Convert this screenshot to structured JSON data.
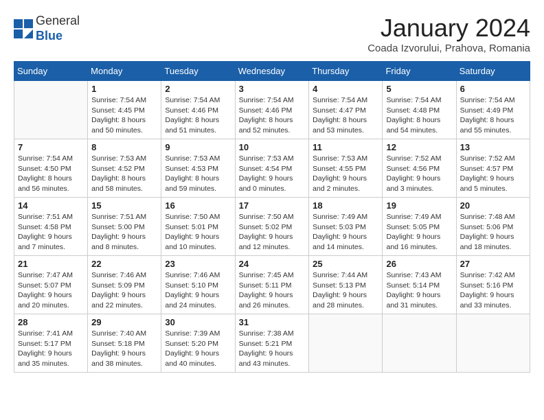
{
  "header": {
    "logo": {
      "line1": "General",
      "line2": "Blue"
    },
    "title": "January 2024",
    "location": "Coada Izvorului, Prahova, Romania"
  },
  "days_of_week": [
    "Sunday",
    "Monday",
    "Tuesday",
    "Wednesday",
    "Thursday",
    "Friday",
    "Saturday"
  ],
  "weeks": [
    [
      {
        "day": "",
        "info": ""
      },
      {
        "day": "1",
        "info": "Sunrise: 7:54 AM\nSunset: 4:45 PM\nDaylight: 8 hours\nand 50 minutes."
      },
      {
        "day": "2",
        "info": "Sunrise: 7:54 AM\nSunset: 4:46 PM\nDaylight: 8 hours\nand 51 minutes."
      },
      {
        "day": "3",
        "info": "Sunrise: 7:54 AM\nSunset: 4:46 PM\nDaylight: 8 hours\nand 52 minutes."
      },
      {
        "day": "4",
        "info": "Sunrise: 7:54 AM\nSunset: 4:47 PM\nDaylight: 8 hours\nand 53 minutes."
      },
      {
        "day": "5",
        "info": "Sunrise: 7:54 AM\nSunset: 4:48 PM\nDaylight: 8 hours\nand 54 minutes."
      },
      {
        "day": "6",
        "info": "Sunrise: 7:54 AM\nSunset: 4:49 PM\nDaylight: 8 hours\nand 55 minutes."
      }
    ],
    [
      {
        "day": "7",
        "info": "Sunrise: 7:54 AM\nSunset: 4:50 PM\nDaylight: 8 hours\nand 56 minutes."
      },
      {
        "day": "8",
        "info": "Sunrise: 7:53 AM\nSunset: 4:52 PM\nDaylight: 8 hours\nand 58 minutes."
      },
      {
        "day": "9",
        "info": "Sunrise: 7:53 AM\nSunset: 4:53 PM\nDaylight: 8 hours\nand 59 minutes."
      },
      {
        "day": "10",
        "info": "Sunrise: 7:53 AM\nSunset: 4:54 PM\nDaylight: 9 hours\nand 0 minutes."
      },
      {
        "day": "11",
        "info": "Sunrise: 7:53 AM\nSunset: 4:55 PM\nDaylight: 9 hours\nand 2 minutes."
      },
      {
        "day": "12",
        "info": "Sunrise: 7:52 AM\nSunset: 4:56 PM\nDaylight: 9 hours\nand 3 minutes."
      },
      {
        "day": "13",
        "info": "Sunrise: 7:52 AM\nSunset: 4:57 PM\nDaylight: 9 hours\nand 5 minutes."
      }
    ],
    [
      {
        "day": "14",
        "info": "Sunrise: 7:51 AM\nSunset: 4:58 PM\nDaylight: 9 hours\nand 7 minutes."
      },
      {
        "day": "15",
        "info": "Sunrise: 7:51 AM\nSunset: 5:00 PM\nDaylight: 9 hours\nand 8 minutes."
      },
      {
        "day": "16",
        "info": "Sunrise: 7:50 AM\nSunset: 5:01 PM\nDaylight: 9 hours\nand 10 minutes."
      },
      {
        "day": "17",
        "info": "Sunrise: 7:50 AM\nSunset: 5:02 PM\nDaylight: 9 hours\nand 12 minutes."
      },
      {
        "day": "18",
        "info": "Sunrise: 7:49 AM\nSunset: 5:03 PM\nDaylight: 9 hours\nand 14 minutes."
      },
      {
        "day": "19",
        "info": "Sunrise: 7:49 AM\nSunset: 5:05 PM\nDaylight: 9 hours\nand 16 minutes."
      },
      {
        "day": "20",
        "info": "Sunrise: 7:48 AM\nSunset: 5:06 PM\nDaylight: 9 hours\nand 18 minutes."
      }
    ],
    [
      {
        "day": "21",
        "info": "Sunrise: 7:47 AM\nSunset: 5:07 PM\nDaylight: 9 hours\nand 20 minutes."
      },
      {
        "day": "22",
        "info": "Sunrise: 7:46 AM\nSunset: 5:09 PM\nDaylight: 9 hours\nand 22 minutes."
      },
      {
        "day": "23",
        "info": "Sunrise: 7:46 AM\nSunset: 5:10 PM\nDaylight: 9 hours\nand 24 minutes."
      },
      {
        "day": "24",
        "info": "Sunrise: 7:45 AM\nSunset: 5:11 PM\nDaylight: 9 hours\nand 26 minutes."
      },
      {
        "day": "25",
        "info": "Sunrise: 7:44 AM\nSunset: 5:13 PM\nDaylight: 9 hours\nand 28 minutes."
      },
      {
        "day": "26",
        "info": "Sunrise: 7:43 AM\nSunset: 5:14 PM\nDaylight: 9 hours\nand 31 minutes."
      },
      {
        "day": "27",
        "info": "Sunrise: 7:42 AM\nSunset: 5:16 PM\nDaylight: 9 hours\nand 33 minutes."
      }
    ],
    [
      {
        "day": "28",
        "info": "Sunrise: 7:41 AM\nSunset: 5:17 PM\nDaylight: 9 hours\nand 35 minutes."
      },
      {
        "day": "29",
        "info": "Sunrise: 7:40 AM\nSunset: 5:18 PM\nDaylight: 9 hours\nand 38 minutes."
      },
      {
        "day": "30",
        "info": "Sunrise: 7:39 AM\nSunset: 5:20 PM\nDaylight: 9 hours\nand 40 minutes."
      },
      {
        "day": "31",
        "info": "Sunrise: 7:38 AM\nSunset: 5:21 PM\nDaylight: 9 hours\nand 43 minutes."
      },
      {
        "day": "",
        "info": ""
      },
      {
        "day": "",
        "info": ""
      },
      {
        "day": "",
        "info": ""
      }
    ]
  ]
}
